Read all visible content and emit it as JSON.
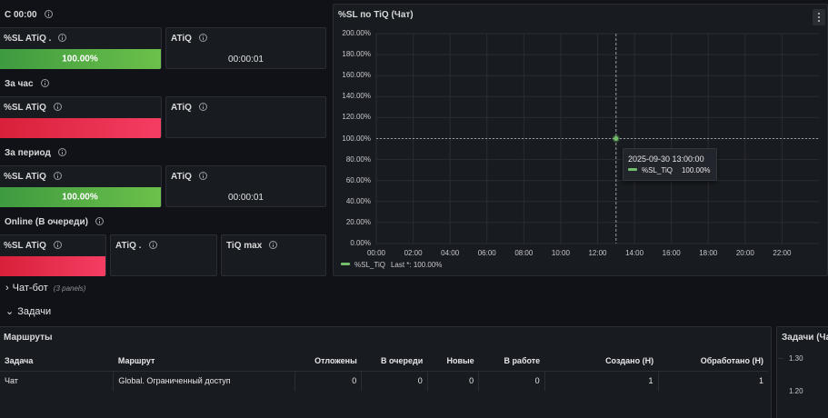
{
  "rows": {
    "since_midnight": {
      "label": "С 00:00"
    },
    "hour": {
      "label": "За час"
    },
    "period": {
      "label": "За период"
    },
    "online": {
      "label": "Online (В очереди)"
    }
  },
  "stats": {
    "sl1": {
      "title": "%SL ATiQ .",
      "value": "100.00%",
      "level": 1.0,
      "color": "#73bf69"
    },
    "atiq1": {
      "title": "ATiQ",
      "value": "00:00:01"
    },
    "sl2": {
      "title": "%SL ATiQ",
      "color": "#f2495c"
    },
    "atiq2": {
      "title": "ATiQ"
    },
    "sl3": {
      "title": "%SL ATiQ",
      "value": "100.00%",
      "level": 1.0,
      "color": "#73bf69"
    },
    "atiq3": {
      "title": "ATiQ",
      "value": "00:00:01"
    },
    "sl4": {
      "title": "%SL ATiQ",
      "color": "#f2495c"
    },
    "atiq4": {
      "title": "ATiQ ."
    },
    "tiqmax": {
      "title": "TiQ max"
    }
  },
  "chart_panel": {
    "title": "%SL по TiQ (Чат)",
    "legend_series": "%SL_TiQ",
    "legend_value": "Last *: 100.00%",
    "tooltip": {
      "time": "2025-09-30 13:00:00",
      "series": "%SL_TiQ",
      "value": "100.00%"
    }
  },
  "chart_data": {
    "type": "line",
    "title": "%SL по TiQ (Чат)",
    "x_ticks": [
      "00:00",
      "02:00",
      "04:00",
      "06:00",
      "08:00",
      "10:00",
      "12:00",
      "14:00",
      "16:00",
      "18:00",
      "20:00",
      "22:00"
    ],
    "y_ticks": [
      "0.00%",
      "20.00%",
      "40.00%",
      "60.00%",
      "80.00%",
      "100.00%",
      "120.00%",
      "140.00%",
      "160.00%",
      "180.00%",
      "200.00%"
    ],
    "ylim": [
      0,
      200
    ],
    "xlim_hours": [
      0,
      24
    ],
    "series": [
      {
        "name": "%SL_TiQ",
        "color": "#73bf69",
        "points": [
          {
            "x": "13:00",
            "y": 100
          }
        ]
      }
    ],
    "threshold": 100,
    "cursor_x": "13:00",
    "grid": true,
    "legend": "bottom-left"
  },
  "sections": {
    "chatbot": {
      "label": "Чат-бот",
      "sub": "(3 panels)"
    },
    "tasks": {
      "label": "Задачи"
    }
  },
  "routes": {
    "title": "Маршруты",
    "columns": [
      "Задача",
      "Маршрут",
      "Отложены",
      "В очереди",
      "Новые",
      "В работе",
      "Создано (Н)",
      "Обработано (Н)"
    ],
    "rows": [
      [
        "Чат",
        "Global. Ограниченный доступ",
        "0",
        "0",
        "0",
        "0",
        "1",
        "1"
      ]
    ]
  },
  "tasks_panel": {
    "title": "Задачи (Ча",
    "y_ticks": [
      "1.30",
      "1.20"
    ]
  }
}
